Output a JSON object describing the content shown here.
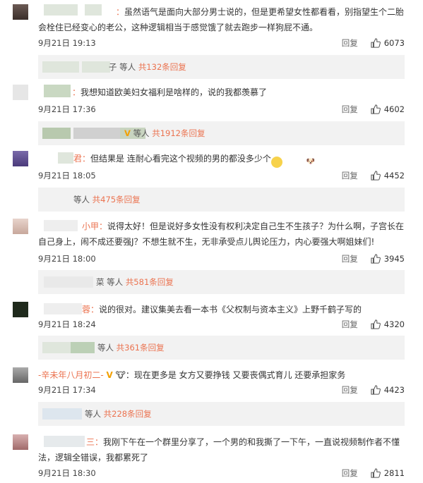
{
  "comments": [
    {
      "name": "：",
      "text": "虽然语气是面向大部分男士说的，但是更希望女性都看看，别指望生个二胎会栓住已经变心的老公，这种逻辑相当于感觉饿了就去跑步一样狗屁不通。",
      "date": "9月21日 19:13",
      "reply_label": "回复",
      "likes": "6073",
      "sub_names": "子 等人",
      "sub_link": "共132条回复",
      "avatar_color": "#4a3a36"
    },
    {
      "name": "：",
      "text": "我想知道欧美妇女福利是啥样的，说的我都羡慕了",
      "date": "9月21日 17:36",
      "reply_label": "回复",
      "likes": "4602",
      "sub_badge": "V",
      "sub_names": "等人",
      "sub_link": "共1912条回复",
      "avatar_color": "#d9d9d9"
    },
    {
      "name": "君：",
      "text": "但结果是 连耐心看完这个视频的男的都没多少个",
      "emoji": "dog-face-emoji",
      "date": "9月21日 18:05",
      "reply_label": "回复",
      "likes": "4452",
      "sub_names": "等人",
      "sub_link": "共475条回复",
      "avatar_color": "#5a4a8a"
    },
    {
      "name": "小甲：",
      "text": "说得太好！但是说好多女性没有权利决定自己生不生孩子？为什么啊，子宫长在自己身上，闹不成还要强J？不想生就不生，无非承受点儿舆论压力，内心要强大啊姐妹们!",
      "date": "9月21日 18:00",
      "reply_label": "回复",
      "likes": "3945",
      "sub_names": "菜 等人",
      "sub_link": "共581条回复",
      "avatar_color": "#d8c0b8"
    },
    {
      "name": "蓉：",
      "text": "说的很对。建议集美去看一本书《父权制与资本主义》上野千鹤子写的",
      "date": "9月21日 18:24",
      "reply_label": "回复",
      "likes": "4320",
      "sub_names": "等人",
      "sub_link": "共361条回复",
      "avatar_color": "#1f2a1c"
    },
    {
      "name": "-辛未年八月初二-",
      "name_badge": "V",
      "text": "：现在更多是 女方又要挣钱 又要丧偶式育儿 还要承担家务",
      "date": "9月21日 17:34",
      "reply_label": "回复",
      "likes": "4423",
      "sub_names": "等人",
      "sub_link": "共228条回复",
      "avatar_color": "#888888"
    },
    {
      "name": "三：",
      "text": "我刚下午在一个群里分享了，一个男的和我撕了一下午，一直说视频制作者不懂法，逻辑全错误，我都累死了",
      "date": "9月21日 18:30",
      "reply_label": "回复",
      "likes": "2811",
      "avatar_color": "#c89a9a"
    }
  ],
  "colors": {
    "accent": "#eb7350",
    "sub_bg": "#f2f2f2",
    "vip": "#f2a000"
  },
  "icons": {
    "like": "thumbs-up-icon"
  }
}
